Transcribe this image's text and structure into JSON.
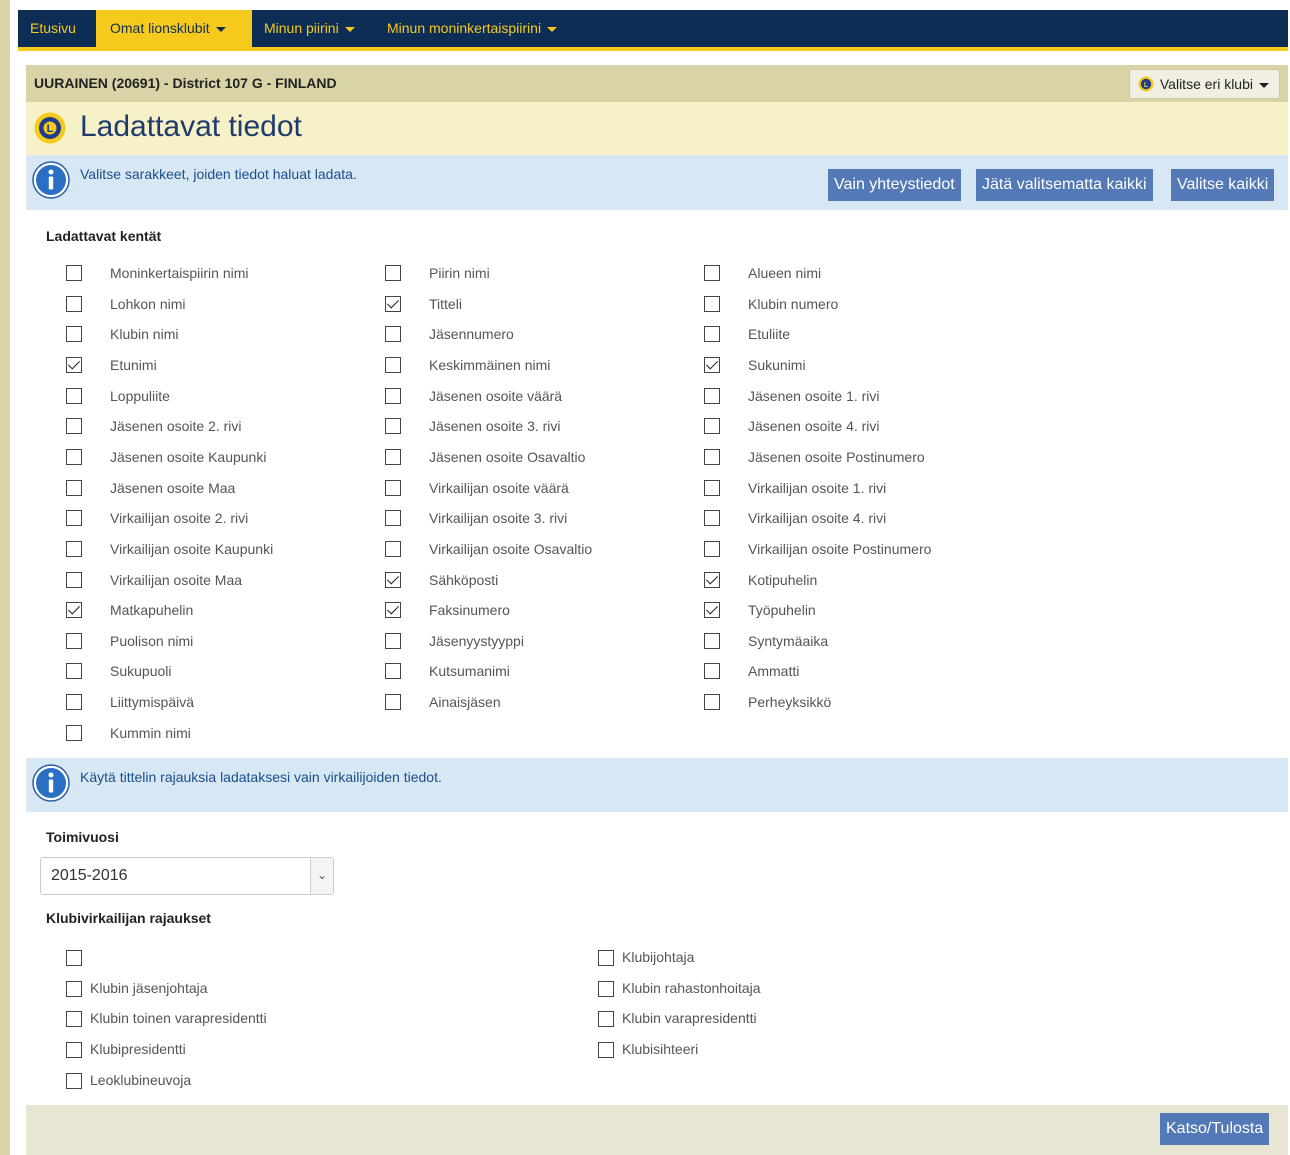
{
  "nav": {
    "items": [
      {
        "label": "Etusivu",
        "has_caret": false
      },
      {
        "label": "Omat lionsklubit",
        "has_caret": true
      },
      {
        "label": "Minun piirini",
        "has_caret": true
      },
      {
        "label": "Minun moninkertaispiirini",
        "has_caret": true
      }
    ]
  },
  "club_bar": {
    "title": "UURAINEN (20691) - District 107 G - FINLAND",
    "select_label": "Valitse eri klubi"
  },
  "page": {
    "title": "Ladattavat tiedot"
  },
  "info1": {
    "text": "Valitse sarakkeet, joiden tiedot haluat ladata.",
    "buttons": [
      "Vain yhteystiedot",
      "Jätä valitsematta kaikki",
      "Valitse kaikki"
    ]
  },
  "fields": {
    "heading": "Ladattavat kentät",
    "items": [
      {
        "label": "Moninkertaispiirin nimi",
        "checked": false
      },
      {
        "label": "Piirin nimi",
        "checked": false
      },
      {
        "label": "Alueen nimi",
        "checked": false
      },
      {
        "label": "Lohkon nimi",
        "checked": false
      },
      {
        "label": "Titteli",
        "checked": true
      },
      {
        "label": "Klubin numero",
        "checked": false
      },
      {
        "label": "Klubin nimi",
        "checked": false
      },
      {
        "label": "Jäsennumero",
        "checked": false
      },
      {
        "label": "Etuliite",
        "checked": false
      },
      {
        "label": "Etunimi",
        "checked": true
      },
      {
        "label": "Keskimmäinen nimi",
        "checked": false
      },
      {
        "label": "Sukunimi",
        "checked": true
      },
      {
        "label": "Loppuliite",
        "checked": false
      },
      {
        "label": "Jäsenen osoite väärä",
        "checked": false
      },
      {
        "label": "Jäsenen osoite 1. rivi",
        "checked": false
      },
      {
        "label": "Jäsenen osoite 2. rivi",
        "checked": false
      },
      {
        "label": "Jäsenen osoite 3. rivi",
        "checked": false
      },
      {
        "label": "Jäsenen osoite 4. rivi",
        "checked": false
      },
      {
        "label": "Jäsenen osoite Kaupunki",
        "checked": false
      },
      {
        "label": "Jäsenen osoite Osavaltio",
        "checked": false
      },
      {
        "label": "Jäsenen osoite Postinumero",
        "checked": false
      },
      {
        "label": "Jäsenen osoite Maa",
        "checked": false
      },
      {
        "label": "Virkailijan osoite väärä",
        "checked": false
      },
      {
        "label": "Virkailijan osoite 1. rivi",
        "checked": false
      },
      {
        "label": "Virkailijan osoite 2. rivi",
        "checked": false
      },
      {
        "label": "Virkailijan osoite 3. rivi",
        "checked": false
      },
      {
        "label": "Virkailijan osoite 4. rivi",
        "checked": false
      },
      {
        "label": "Virkailijan osoite Kaupunki",
        "checked": false
      },
      {
        "label": "Virkailijan osoite Osavaltio",
        "checked": false
      },
      {
        "label": "Virkailijan osoite Postinumero",
        "checked": false
      },
      {
        "label": "Virkailijan osoite Maa",
        "checked": false
      },
      {
        "label": "Sähköposti",
        "checked": true
      },
      {
        "label": "Kotipuhelin",
        "checked": true
      },
      {
        "label": "Matkapuhelin",
        "checked": true
      },
      {
        "label": "Faksinumero",
        "checked": true
      },
      {
        "label": "Työpuhelin",
        "checked": true
      },
      {
        "label": "Puolison nimi",
        "checked": false
      },
      {
        "label": "Jäsenyystyyppi",
        "checked": false
      },
      {
        "label": "Syntymäaika",
        "checked": false
      },
      {
        "label": "Sukupuoli",
        "checked": false
      },
      {
        "label": "Kutsumanimi",
        "checked": false
      },
      {
        "label": "Ammatti",
        "checked": false
      },
      {
        "label": "Liittymispäivä",
        "checked": false
      },
      {
        "label": "Ainaisjäsen",
        "checked": false
      },
      {
        "label": "Perheyksikkö",
        "checked": false
      },
      {
        "label": "Kummin nimi",
        "checked": false
      }
    ]
  },
  "info2": {
    "text": "Käytä tittelin rajauksia ladataksesi vain virkailijoiden tiedot."
  },
  "year": {
    "label": "Toimivuosi",
    "value": "2015-2016"
  },
  "officers": {
    "heading": "Klubivirkailijan rajaukset",
    "items": [
      {
        "label": "",
        "checked": false
      },
      {
        "label": "Klubijohtaja",
        "checked": false
      },
      {
        "label": "Klubin jäsenjohtaja",
        "checked": false
      },
      {
        "label": "Klubin rahastonhoitaja",
        "checked": false
      },
      {
        "label": "Klubin toinen varapresidentti",
        "checked": false
      },
      {
        "label": "Klubin varapresidentti",
        "checked": false
      },
      {
        "label": "Klubipresidentti",
        "checked": false
      },
      {
        "label": "Klubisihteeri",
        "checked": false
      },
      {
        "label": "Leoklubineuvoja",
        "checked": false
      }
    ]
  },
  "footer": {
    "button_label": "Katso/Tulosta"
  }
}
